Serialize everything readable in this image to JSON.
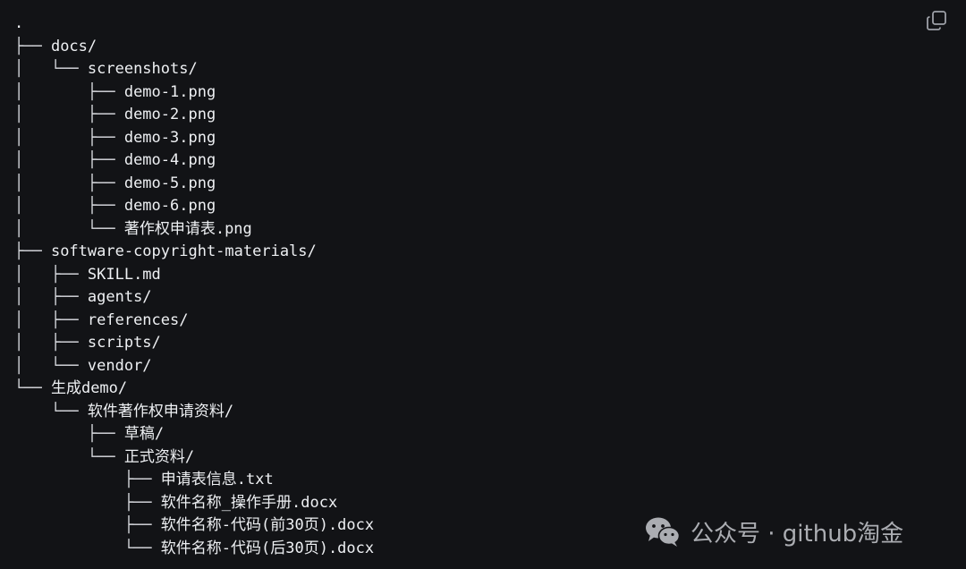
{
  "toolbar": {
    "copy_icon": "copy-icon"
  },
  "tree": {
    "lines": [
      {
        "guides": "",
        "name": "."
      },
      {
        "guides": "├── ",
        "name": "docs/"
      },
      {
        "guides": "│   └── ",
        "name": "screenshots/"
      },
      {
        "guides": "│       ├── ",
        "name": "demo-1.png"
      },
      {
        "guides": "│       ├── ",
        "name": "demo-2.png"
      },
      {
        "guides": "│       ├── ",
        "name": "demo-3.png"
      },
      {
        "guides": "│       ├── ",
        "name": "demo-4.png"
      },
      {
        "guides": "│       ├── ",
        "name": "demo-5.png"
      },
      {
        "guides": "│       ├── ",
        "name": "demo-6.png"
      },
      {
        "guides": "│       └── ",
        "name": "著作权申请表.png"
      },
      {
        "guides": "├── ",
        "name": "software-copyright-materials/"
      },
      {
        "guides": "│   ├── ",
        "name": "SKILL.md"
      },
      {
        "guides": "│   ├── ",
        "name": "agents/"
      },
      {
        "guides": "│   ├── ",
        "name": "references/"
      },
      {
        "guides": "│   ├── ",
        "name": "scripts/"
      },
      {
        "guides": "│   └── ",
        "name": "vendor/"
      },
      {
        "guides": "└── ",
        "name": "生成demo/"
      },
      {
        "guides": "    └── ",
        "name": "软件著作权申请资料/"
      },
      {
        "guides": "        ├── ",
        "name": "草稿/"
      },
      {
        "guides": "        └── ",
        "name": "正式资料/"
      },
      {
        "guides": "            ├── ",
        "name": "申请表信息.txt"
      },
      {
        "guides": "            ├── ",
        "name": "软件名称_操作手册.docx"
      },
      {
        "guides": "            ├── ",
        "name": "软件名称-代码(前30页).docx"
      },
      {
        "guides": "            └── ",
        "name": "软件名称-代码(后30页).docx"
      }
    ]
  },
  "watermark": {
    "icon": "wechat-icon",
    "text": "公众号 · github淘金"
  },
  "colors": {
    "background": "#121316",
    "text": "#e7e9ed",
    "watermark": "#b9bbc0"
  }
}
